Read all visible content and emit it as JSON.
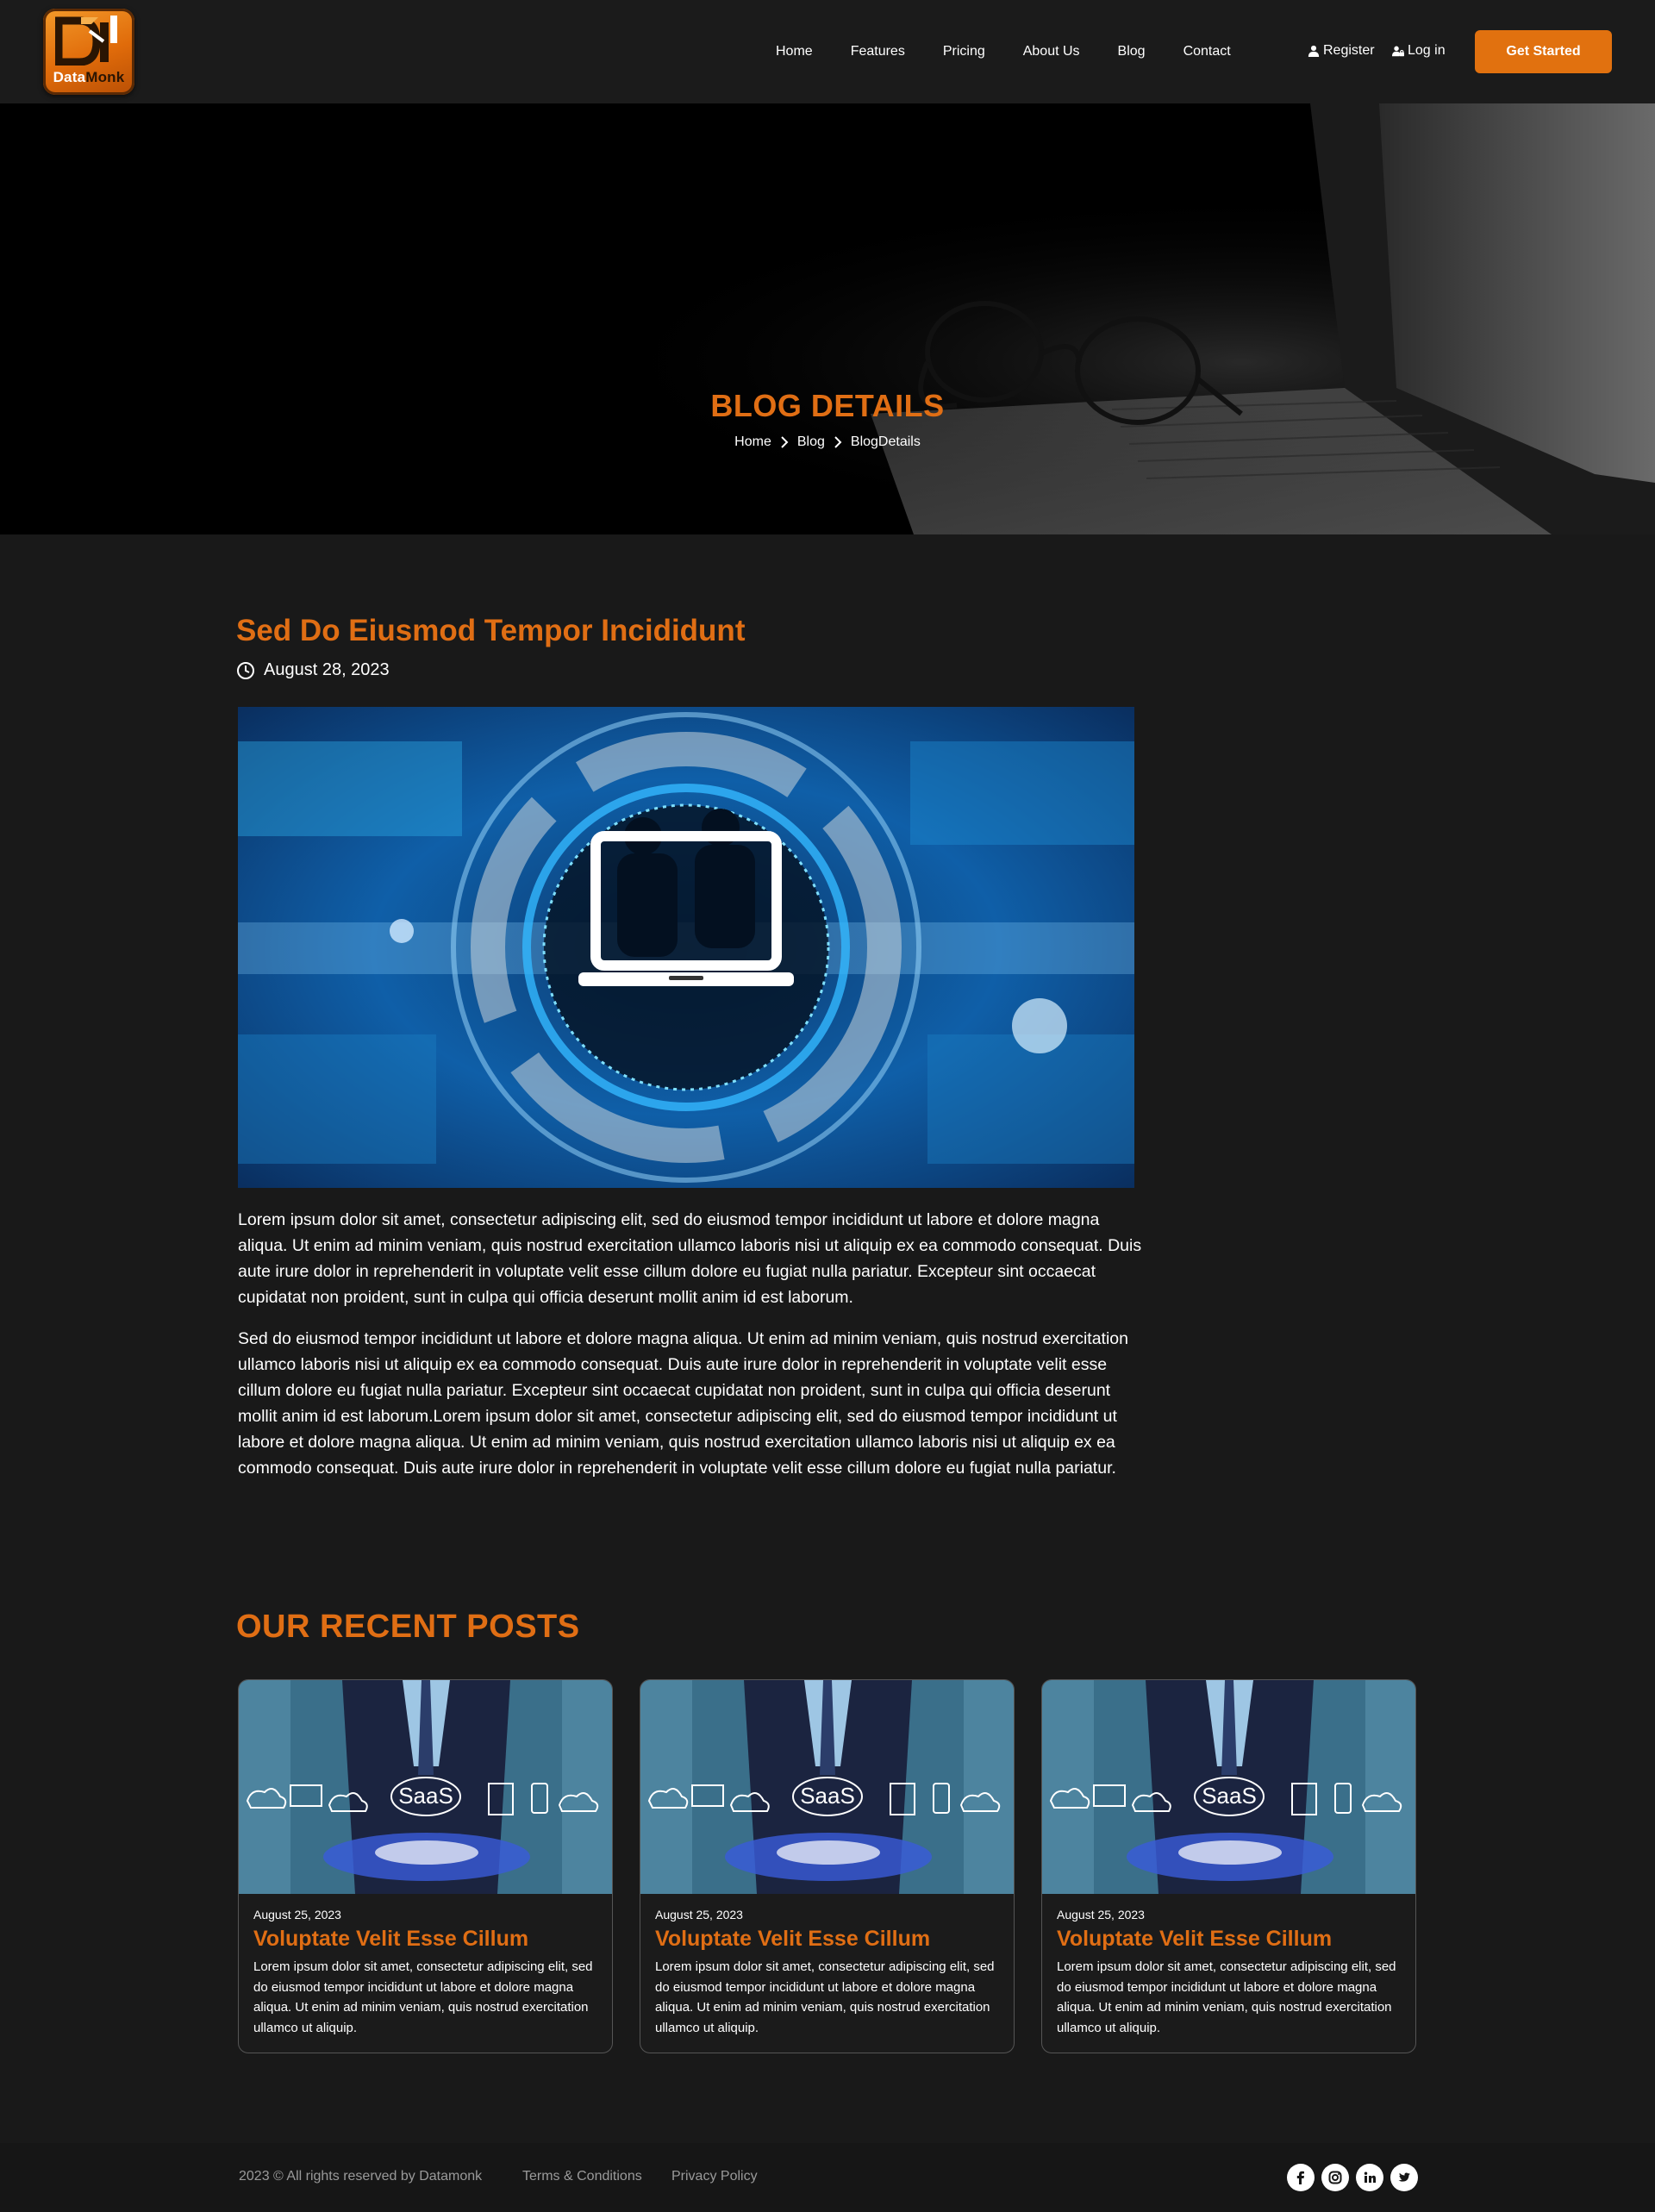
{
  "brand": {
    "logo_text_a": "Data",
    "logo_text_b": "Monk",
    "accent_color": "#e06e14"
  },
  "nav": {
    "links": [
      "Home",
      "Features",
      "Pricing",
      "About Us",
      "Blog",
      "Contact"
    ],
    "register_label": "Register",
    "login_label": "Log in",
    "cta_label": "Get Started"
  },
  "hero": {
    "title": "BLOG DETAILS",
    "breadcrumb": [
      "Home",
      "Blog",
      "BlogDetails"
    ]
  },
  "post": {
    "title": "Sed Do Eiusmod Tempor Incididunt",
    "date": "August 28, 2023",
    "paragraphs": [
      "Lorem ipsum dolor sit amet, consectetur adipiscing elit, sed do eiusmod tempor incididunt ut labore et dolore magna aliqua. Ut enim ad minim veniam, quis nostrud exercitation ullamco laboris nisi ut aliquip ex ea commodo consequat. Duis aute irure dolor in reprehenderit in voluptate velit esse cillum dolore eu fugiat nulla pariatur. Excepteur sint occaecat cupidatat non proident, sunt in culpa qui officia deserunt mollit anim id est laborum.",
      "Sed do eiusmod tempor incididunt ut labore et dolore magna aliqua. Ut enim ad minim veniam, quis nostrud exercitation ullamco laboris nisi ut aliquip ex ea commodo consequat. Duis aute irure dolor in reprehenderit in voluptate velit esse cillum dolore eu fugiat nulla pariatur. Excepteur sint occaecat cupidatat non proident, sunt in culpa qui officia deserunt mollit anim id est laborum.Lorem ipsum dolor sit amet, consectetur adipiscing elit, sed do eiusmod tempor incididunt ut labore et dolore magna aliqua. Ut enim ad minim veniam, quis nostrud exercitation ullamco laboris nisi ut aliquip ex ea commodo consequat. Duis aute irure dolor in reprehenderit in voluptate velit esse cillum dolore eu fugiat nulla pariatur."
    ]
  },
  "recent": {
    "title": "OUR RECENT POSTS",
    "image_caption": "SaaS",
    "cards": [
      {
        "date": "August 25, 2023",
        "title": "Voluptate Velit Esse Cillum",
        "text": "Lorem ipsum dolor sit amet, consectetur adipiscing elit, sed do eiusmod tempor incididunt ut labore et dolore magna aliqua. Ut enim ad minim veniam, quis nostrud exercitation ullamco ut aliquip."
      },
      {
        "date": "August 25, 2023",
        "title": "Voluptate Velit Esse Cillum",
        "text": "Lorem ipsum dolor sit amet, consectetur adipiscing elit, sed do eiusmod tempor incididunt ut labore et dolore magna aliqua. Ut enim ad minim veniam, quis nostrud exercitation ullamco ut aliquip."
      },
      {
        "date": "August 25, 2023",
        "title": "Voluptate Velit Esse Cillum",
        "text": "Lorem ipsum dolor sit amet, consectetur adipiscing elit, sed do eiusmod tempor incididunt ut labore et dolore magna aliqua. Ut enim ad minim veniam, quis nostrud exercitation ullamco ut aliquip."
      }
    ]
  },
  "footer": {
    "copyright": "2023 © All rights reserved by Datamonk",
    "terms": "Terms & Conditions",
    "privacy": "Privacy Policy",
    "social_icons": [
      "facebook-icon",
      "instagram-icon",
      "linkedin-icon",
      "twitter-icon"
    ]
  }
}
